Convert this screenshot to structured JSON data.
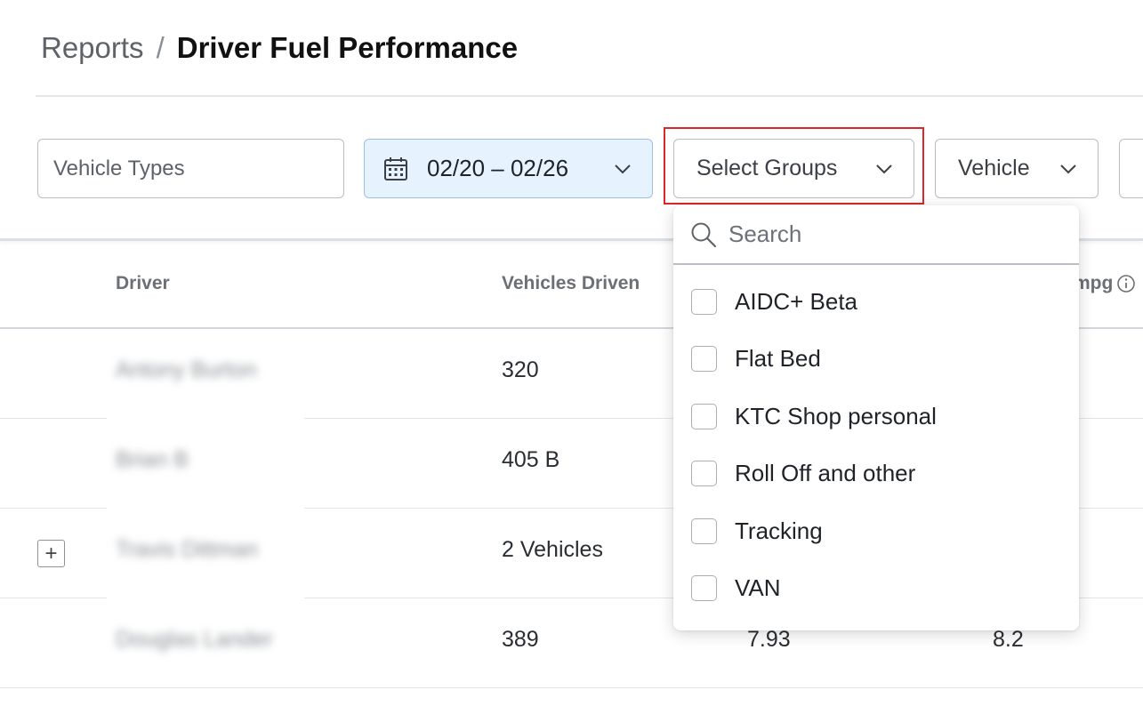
{
  "breadcrumb": {
    "parent": "Reports",
    "separator": "/",
    "current": "Driver Fuel Performance"
  },
  "filters": {
    "vehicle_types_placeholder": "Vehicle Types",
    "date_range": "02/20 – 02/26",
    "groups_label": "Select Groups",
    "vehicle_label": "Vehicle"
  },
  "groups_dropdown": {
    "search_placeholder": "Search",
    "options": [
      {
        "label": "AIDC+ Beta",
        "checked": false
      },
      {
        "label": "Flat Bed",
        "checked": false
      },
      {
        "label": "KTC Shop personal",
        "checked": false
      },
      {
        "label": "Roll Off and other",
        "checked": false
      },
      {
        "label": "Tracking",
        "checked": false
      },
      {
        "label": "VAN",
        "checked": false
      }
    ]
  },
  "table": {
    "columns": [
      "Driver",
      "Vehicles Driven",
      "",
      "mpg"
    ],
    "rows": [
      {
        "driver": "Antony Burton",
        "vehicles": "320",
        "col3": "",
        "col4": "",
        "expandable": false
      },
      {
        "driver": "Brian B",
        "vehicles": "405 B",
        "col3": "",
        "col4": "",
        "expandable": false
      },
      {
        "driver": "Travis Dittman",
        "vehicles": "2 Vehicles",
        "col3": "",
        "col4": "",
        "expandable": true,
        "expand_symbol": "+"
      },
      {
        "driver": "Douglas Lander",
        "vehicles": "389",
        "col3": "7.93",
        "col4": "8.2",
        "expandable": false
      }
    ]
  },
  "colors": {
    "date_filter_bg": "#e6f2fd",
    "highlight_border": "#d9272b"
  },
  "icons": {
    "date": "calendar-icon",
    "dropdown": "chevron-down-icon",
    "search": "search-icon",
    "info": "info-icon"
  }
}
